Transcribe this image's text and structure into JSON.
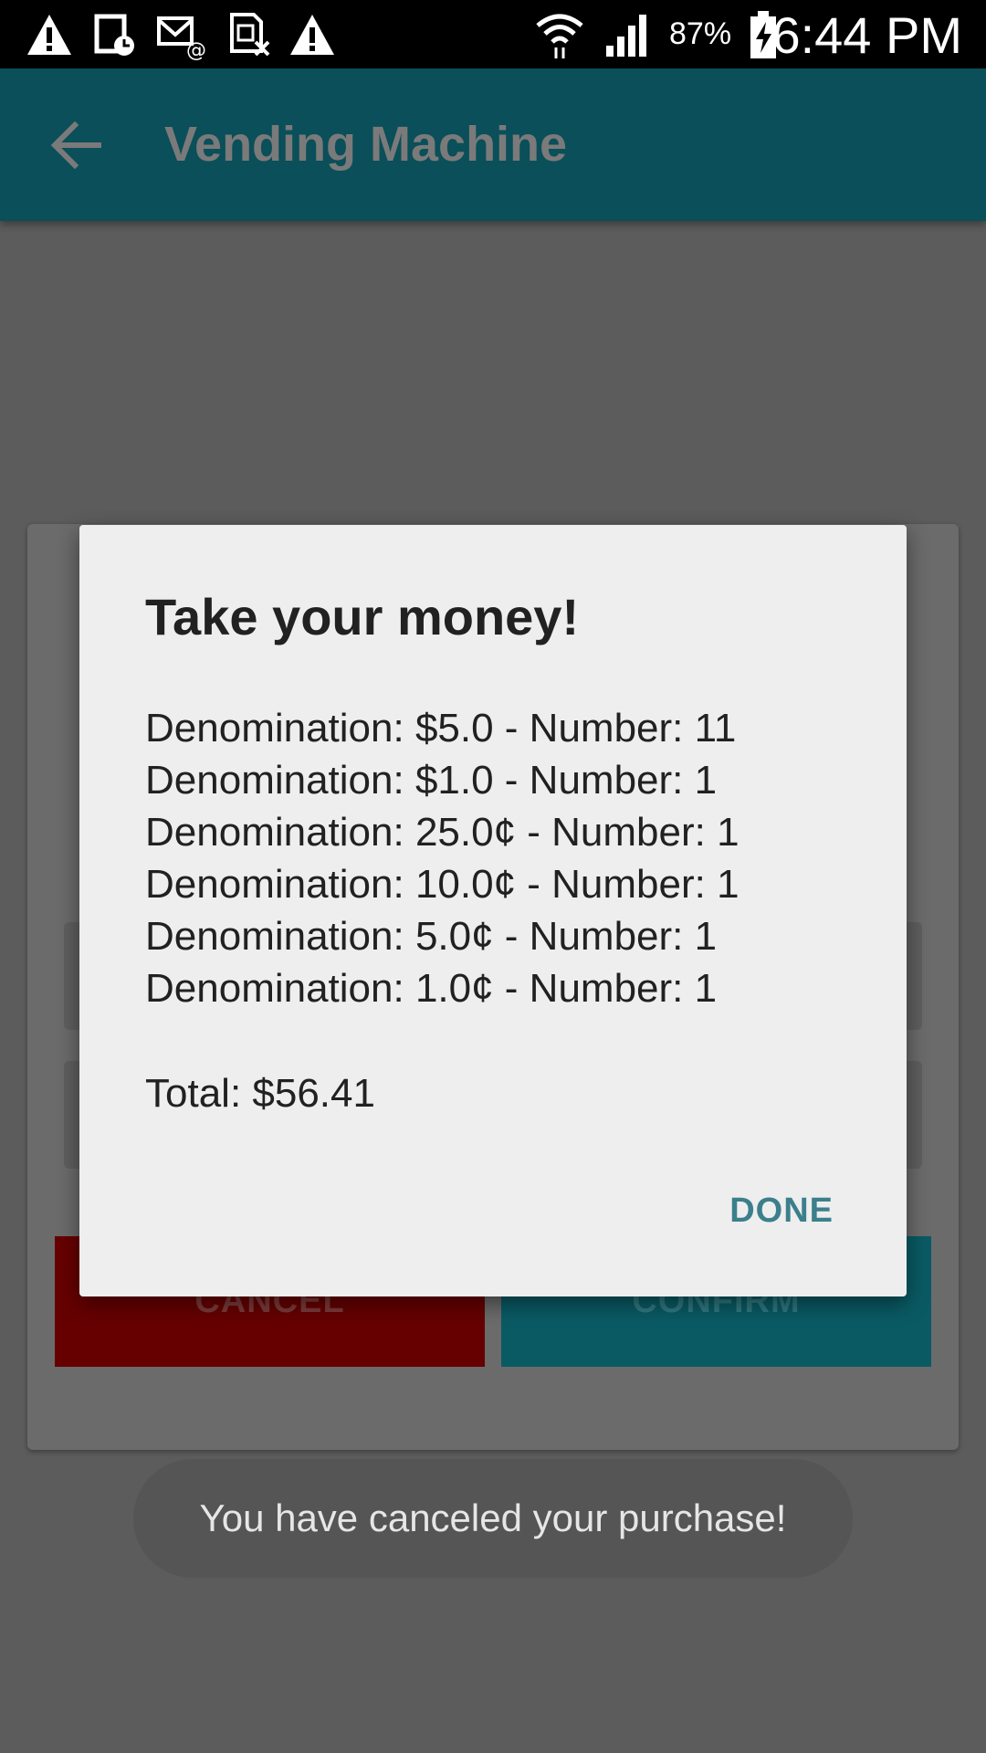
{
  "status_bar": {
    "battery": "87%",
    "time": "6:44 PM",
    "icons": [
      "warning-icon",
      "calendar-alarm-icon",
      "email-icon",
      "sim-error-icon",
      "warning-icon",
      "wifi-icon",
      "signal-icon",
      "battery-charging-icon"
    ]
  },
  "toolbar": {
    "title": "Vending Machine",
    "back_icon": "arrow-back-icon",
    "background": "#0a4f59"
  },
  "background_screen": {
    "cancel_label": "CANCEL",
    "confirm_label": "CONFIRM",
    "cancel_color": "#660000",
    "confirm_color": "#0a5a64"
  },
  "dialog": {
    "title": "Take your money!",
    "lines": [
      "Denomination: $5.0 - Number: 11",
      "Denomination: $1.0 - Number: 1",
      "Denomination: 25.0¢ - Number: 1",
      "Denomination: 10.0¢ - Number: 1",
      "Denomination: 5.0¢ - Number: 1",
      "Denomination: 1.0¢ - Number: 1"
    ],
    "total": "Total: $56.41",
    "done_label": "DONE"
  },
  "toast": {
    "message": "You have canceled your purchase!"
  }
}
